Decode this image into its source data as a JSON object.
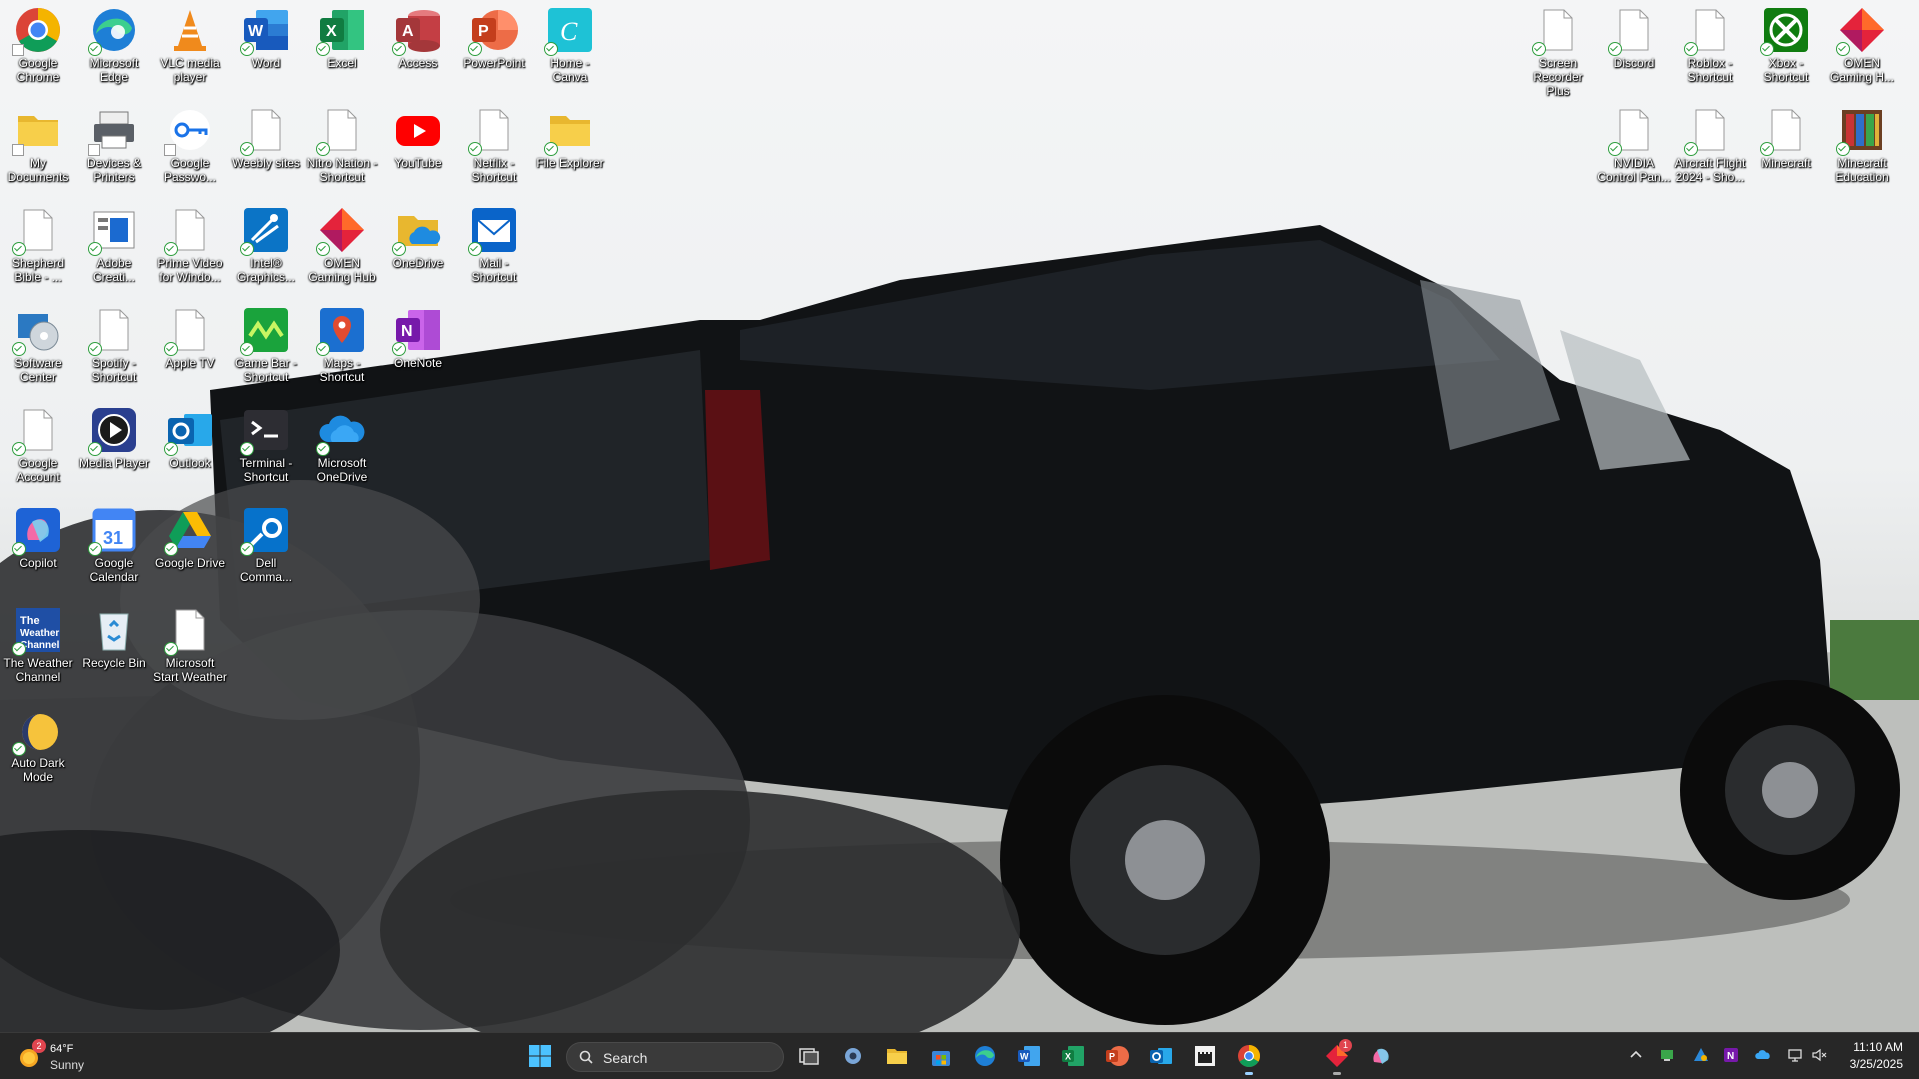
{
  "desktop": {
    "icons": [
      {
        "label": "Google Chrome",
        "icon": "chrome-icon"
      },
      {
        "label": "Microsoft Edge",
        "icon": "edge-icon"
      },
      {
        "label": "VLC media player",
        "icon": "vlc-icon"
      },
      {
        "label": "Word",
        "icon": "word-icon"
      },
      {
        "label": "Excel",
        "icon": "excel-icon"
      },
      {
        "label": "Access",
        "icon": "access-icon"
      },
      {
        "label": "PowerPoint",
        "icon": "powerpoint-icon"
      },
      {
        "label": "Home - Canva",
        "icon": "canva-icon"
      },
      {
        "label": "My Documents",
        "icon": "folder-icon"
      },
      {
        "label": "Devices & Printers",
        "icon": "printer-icon"
      },
      {
        "label": "Google Passwo...",
        "icon": "key-icon"
      },
      {
        "label": "Weebly sites",
        "icon": "file-icon"
      },
      {
        "label": "Nitro Nation - Shortcut",
        "icon": "file-icon"
      },
      {
        "label": "YouTube",
        "icon": "youtube-icon"
      },
      {
        "label": "Netflix - Shortcut",
        "icon": "file-icon"
      },
      {
        "label": "File Explorer",
        "icon": "folder-icon"
      },
      {
        "label": "Shepherd Bible - ...",
        "icon": "file-icon"
      },
      {
        "label": "Adobe Creati...",
        "icon": "adobe-icon"
      },
      {
        "label": "Prime Video for Windo...",
        "icon": "file-icon"
      },
      {
        "label": "Intel® Graphics...",
        "icon": "intel-icon"
      },
      {
        "label": "OMEN Gaming Hub",
        "icon": "omen-icon"
      },
      {
        "label": "OneDrive",
        "icon": "onedrive-folder-icon"
      },
      {
        "label": "Mail - Shortcut",
        "icon": "mail-icon"
      },
      {
        "label": "Software Center",
        "icon": "software-center-icon"
      },
      {
        "label": "Spotify - Shortcut",
        "icon": "file-icon"
      },
      {
        "label": "Apple TV",
        "icon": "file-icon"
      },
      {
        "label": "Game Bar - Shortcut",
        "icon": "gamebar-icon"
      },
      {
        "label": "Maps - Shortcut",
        "icon": "maps-icon"
      },
      {
        "label": "OneNote",
        "icon": "onenote-icon"
      },
      {
        "label": "Google Account",
        "icon": "file-icon"
      },
      {
        "label": "Media Player",
        "icon": "media-player-icon"
      },
      {
        "label": "Outlook",
        "icon": "outlook-icon"
      },
      {
        "label": "Terminal - Shortcut",
        "icon": "terminal-icon"
      },
      {
        "label": "Microsoft OneDrive",
        "icon": "onedrive-icon"
      },
      {
        "label": "Copilot",
        "icon": "copilot-icon"
      },
      {
        "label": "Google Calendar",
        "icon": "calendar-icon"
      },
      {
        "label": "Google Drive",
        "icon": "drive-icon"
      },
      {
        "label": "Dell Comma...",
        "icon": "dell-command-icon"
      },
      {
        "label": "The Weather Channel",
        "icon": "weather-channel-icon"
      },
      {
        "label": "Recycle Bin",
        "icon": "recycle-bin-icon"
      },
      {
        "label": "Microsoft Start Weather",
        "icon": "file-icon"
      },
      {
        "label": "Auto Dark Mode",
        "icon": "auto-dark-mode-icon"
      },
      {
        "label": "Screen Recorder Plus",
        "icon": "file-icon"
      },
      {
        "label": "Discord",
        "icon": "file-icon"
      },
      {
        "label": "Roblox - Shortcut",
        "icon": "file-icon"
      },
      {
        "label": "Xbox - Shortcut",
        "icon": "xbox-icon"
      },
      {
        "label": "OMEN Gaming H...",
        "icon": "omen-icon"
      },
      {
        "label": "NVIDIA Control Pan...",
        "icon": "file-icon"
      },
      {
        "label": "Aircraft Flight 2024 - Sho...",
        "icon": "file-icon"
      },
      {
        "label": "Minecraft",
        "icon": "file-icon"
      },
      {
        "label": "Minecraft Education",
        "icon": "minecraft-education-icon"
      }
    ]
  },
  "taskbar": {
    "weather": {
      "badge": "2",
      "temperature": "64°F",
      "condition": "Sunny"
    },
    "search_placeholder": "Search",
    "notification_badge": "1",
    "clock": {
      "time": "11:10 AM",
      "date": "3/25/2025"
    }
  }
}
